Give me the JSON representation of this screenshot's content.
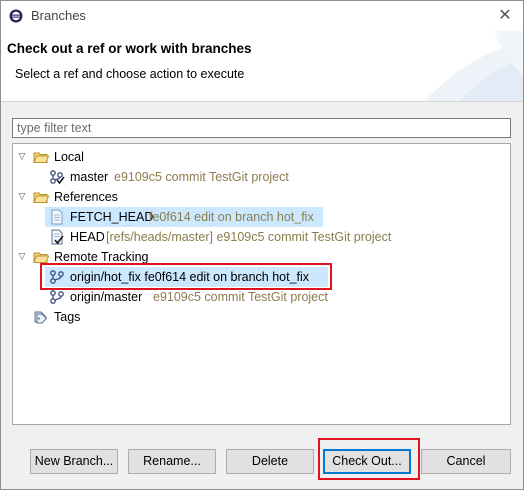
{
  "window": {
    "title": "Branches",
    "close_glyph": "✕"
  },
  "header": {
    "heading": "Check out a ref or work with branches",
    "description": "Select a ref and choose action to execute"
  },
  "filter": {
    "placeholder": "type filter text",
    "value": ""
  },
  "tree": {
    "local": {
      "label": "Local",
      "master": {
        "name": "master",
        "detail": "e9109c5 commit TestGit project"
      }
    },
    "references": {
      "label": "References",
      "fetch_head": {
        "name": "FETCH_HEAD",
        "detail": "fe0f614 edit on branch hot_fix"
      },
      "head": {
        "name": "HEAD",
        "detail": "[refs/heads/master] e9109c5 commit TestGit project"
      }
    },
    "remote_tracking": {
      "label": "Remote Tracking",
      "hot_fix": {
        "text": "origin/hot_fix fe0f614 edit on branch hot_fix"
      },
      "master": {
        "name": "origin/master",
        "detail": "e9109c5 commit TestGit project"
      }
    },
    "tags": {
      "label": "Tags"
    }
  },
  "buttons": {
    "new_branch": "New Branch...",
    "rename": "Rename...",
    "delete": "Delete",
    "checkout": "Check Out...",
    "cancel": "Cancel"
  },
  "colors": {
    "selection": "#cce8ff",
    "highlight_box": "#e0141c",
    "muted_text": "#8b7c4c",
    "folder": "#e8c060"
  },
  "icons": {
    "app": "eclipse-icon",
    "folder": "folder-open-icon",
    "branch": "branch-icon",
    "checked_branch": "checked-out-branch-icon",
    "file": "ref-file-icon",
    "tags": "tags-icon"
  }
}
